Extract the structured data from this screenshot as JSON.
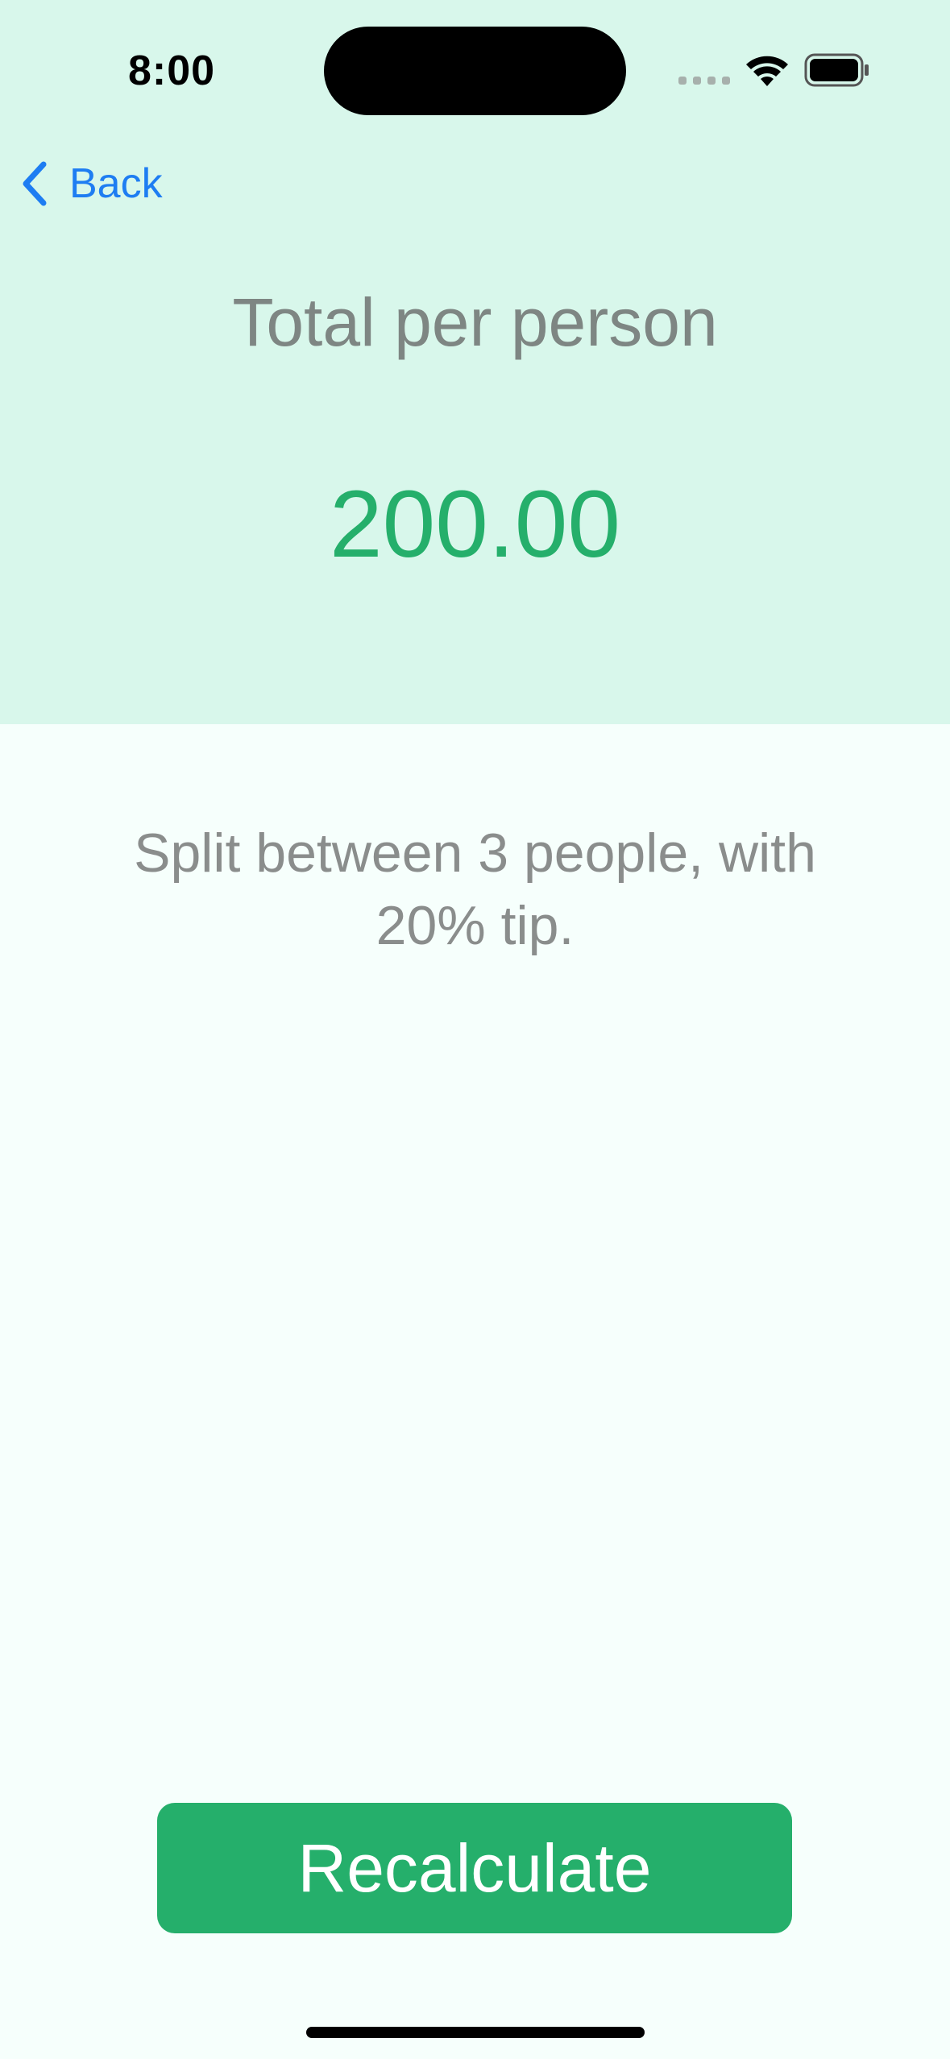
{
  "status_bar": {
    "time": "8:00"
  },
  "nav": {
    "back_label": "Back"
  },
  "result": {
    "title": "Total per person",
    "amount": "200.00",
    "details": "Split between 3 people, with 20% tip."
  },
  "actions": {
    "recalculate_label": "Recalculate"
  },
  "colors": {
    "top_background": "#D8F7EB",
    "page_background": "#F6FFFC",
    "accent_green": "#25AF6B",
    "link_blue": "#1E7DF2",
    "muted_text": "#7E8683"
  },
  "icons": [
    "signal-icon",
    "wifi-icon",
    "battery-icon",
    "chevron-left-icon"
  ]
}
